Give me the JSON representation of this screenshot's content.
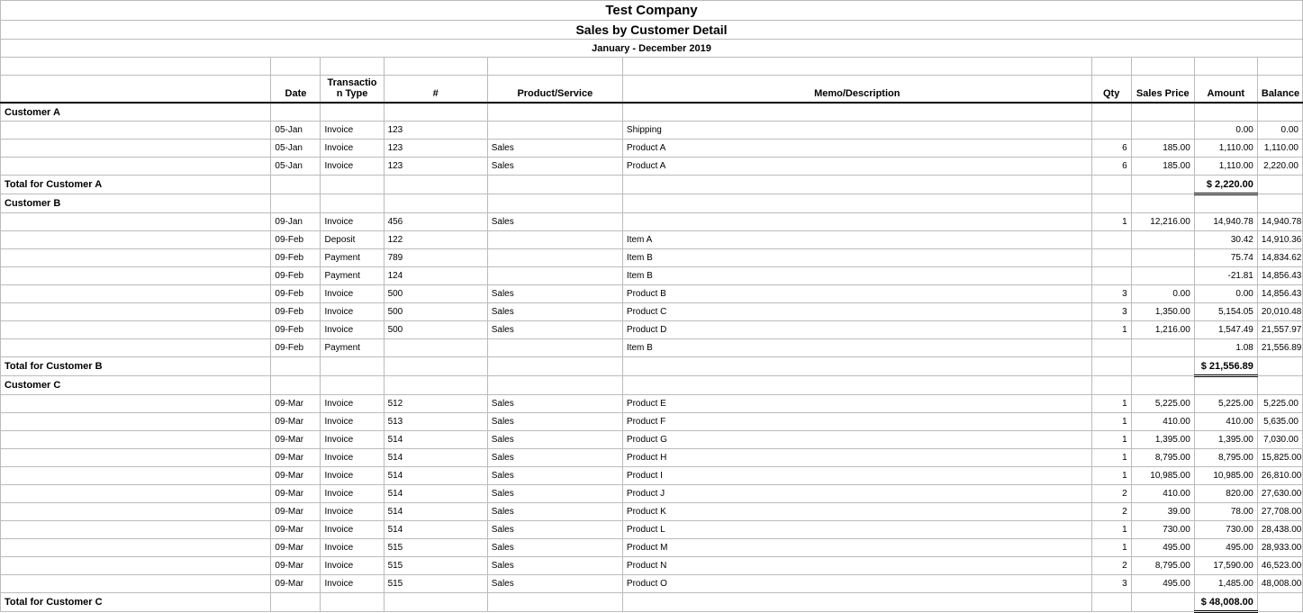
{
  "header": {
    "company": "Test Company",
    "report_title": "Sales by  Customer Detail",
    "period": "January - December 2019"
  },
  "columns": {
    "date": "Date",
    "type": "Transactio\nn Type",
    "num": "#",
    "product": "Product/Service",
    "memo": "Memo/Description",
    "qty": "Qty",
    "price": "Sales Price",
    "amount": "Amount",
    "balance": "Balance"
  },
  "labels": {
    "total_prefix": "Total for "
  },
  "customers": [
    {
      "name": "Customer A",
      "rows": [
        {
          "date": "05-Jan",
          "type": "Invoice",
          "num": "123",
          "product": "",
          "memo": "Shipping",
          "qty": "",
          "price": "",
          "amount": "0.00",
          "balance": "0.00"
        },
        {
          "date": "05-Jan",
          "type": "Invoice",
          "num": "123",
          "product": "Sales",
          "memo": "Product A",
          "qty": "6",
          "price": "185.00",
          "amount": "1,110.00",
          "balance": "1,110.00"
        },
        {
          "date": "05-Jan",
          "type": "Invoice",
          "num": "123",
          "product": "Sales",
          "memo": "Product A",
          "qty": "6",
          "price": "185.00",
          "amount": "1,110.00",
          "balance": "2,220.00"
        }
      ],
      "total": "$   2,220.00"
    },
    {
      "name": "Customer B",
      "rows": [
        {
          "date": "09-Jan",
          "type": "Invoice",
          "num": "456",
          "product": "Sales",
          "memo": "",
          "qty": "1",
          "price": "12,216.00",
          "amount": "14,940.78",
          "balance": "14,940.78"
        },
        {
          "date": "09-Feb",
          "type": "Deposit",
          "num": "122",
          "product": "",
          "memo": "Item A",
          "qty": "",
          "price": "",
          "amount": "30.42",
          "balance": "14,910.36"
        },
        {
          "date": "09-Feb",
          "type": "Payment",
          "num": "789",
          "product": "",
          "memo": "Item B",
          "qty": "",
          "price": "",
          "amount": "75.74",
          "balance": "14,834.62"
        },
        {
          "date": "09-Feb",
          "type": "Payment",
          "num": "124",
          "product": "",
          "memo": "Item B",
          "qty": "",
          "price": "",
          "amount": "-21.81",
          "balance": "14,856.43"
        },
        {
          "date": "09-Feb",
          "type": "Invoice",
          "num": "500",
          "product": "Sales",
          "memo": "Product B",
          "qty": "3",
          "price": "0.00",
          "amount": "0.00",
          "balance": "14,856.43"
        },
        {
          "date": "09-Feb",
          "type": "Invoice",
          "num": "500",
          "product": "Sales",
          "memo": "Product C",
          "qty": "3",
          "price": "1,350.00",
          "amount": "5,154.05",
          "balance": "20,010.48"
        },
        {
          "date": "09-Feb",
          "type": "Invoice",
          "num": "500",
          "product": "Sales",
          "memo": "Product D",
          "qty": "1",
          "price": "1,216.00",
          "amount": "1,547.49",
          "balance": "21,557.97"
        },
        {
          "date": "09-Feb",
          "type": "Payment",
          "num": "",
          "product": "",
          "memo": "Item B",
          "qty": "",
          "price": "",
          "amount": "1.08",
          "balance": "21,556.89"
        }
      ],
      "total": "$  21,556.89"
    },
    {
      "name": "Customer C",
      "rows": [
        {
          "date": "09-Mar",
          "type": "Invoice",
          "num": "512",
          "product": "Sales",
          "memo": "Product E",
          "qty": "1",
          "price": "5,225.00",
          "amount": "5,225.00",
          "balance": "5,225.00"
        },
        {
          "date": "09-Mar",
          "type": "Invoice",
          "num": "513",
          "product": "Sales",
          "memo": "Product F",
          "qty": "1",
          "price": "410.00",
          "amount": "410.00",
          "balance": "5,635.00"
        },
        {
          "date": "09-Mar",
          "type": "Invoice",
          "num": "514",
          "product": "Sales",
          "memo": "Product G",
          "qty": "1",
          "price": "1,395.00",
          "amount": "1,395.00",
          "balance": "7,030.00"
        },
        {
          "date": "09-Mar",
          "type": "Invoice",
          "num": "514",
          "product": "Sales",
          "memo": "Product H",
          "qty": "1",
          "price": "8,795.00",
          "amount": "8,795.00",
          "balance": "15,825.00"
        },
        {
          "date": "09-Mar",
          "type": "Invoice",
          "num": "514",
          "product": "Sales",
          "memo": "Product I",
          "qty": "1",
          "price": "10,985.00",
          "amount": "10,985.00",
          "balance": "26,810.00"
        },
        {
          "date": "09-Mar",
          "type": "Invoice",
          "num": "514",
          "product": "Sales",
          "memo": "Product J",
          "qty": "2",
          "price": "410.00",
          "amount": "820.00",
          "balance": "27,630.00"
        },
        {
          "date": "09-Mar",
          "type": "Invoice",
          "num": "514",
          "product": "Sales",
          "memo": "Product K",
          "qty": "2",
          "price": "39.00",
          "amount": "78.00",
          "balance": "27,708.00"
        },
        {
          "date": "09-Mar",
          "type": "Invoice",
          "num": "514",
          "product": "Sales",
          "memo": "Product L",
          "qty": "1",
          "price": "730.00",
          "amount": "730.00",
          "balance": "28,438.00"
        },
        {
          "date": "09-Mar",
          "type": "Invoice",
          "num": "515",
          "product": "Sales",
          "memo": "Product M",
          "qty": "1",
          "price": "495.00",
          "amount": "495.00",
          "balance": "28,933.00"
        },
        {
          "date": "09-Mar",
          "type": "Invoice",
          "num": "515",
          "product": "Sales",
          "memo": "Product N",
          "qty": "2",
          "price": "8,795.00",
          "amount": "17,590.00",
          "balance": "46,523.00"
        },
        {
          "date": "09-Mar",
          "type": "Invoice",
          "num": "515",
          "product": "Sales",
          "memo": "Product O",
          "qty": "3",
          "price": "495.00",
          "amount": "1,485.00",
          "balance": "48,008.00"
        }
      ],
      "total": "$ 48,008.00"
    }
  ]
}
